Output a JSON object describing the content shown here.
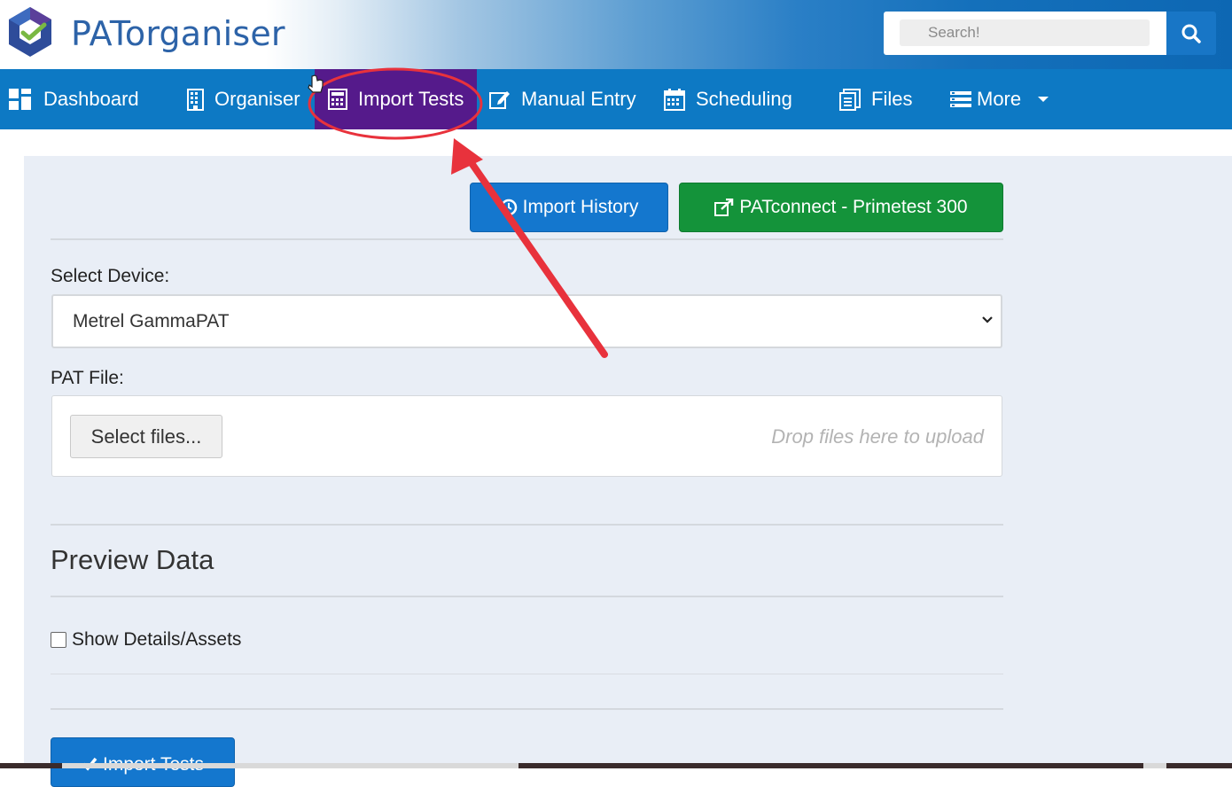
{
  "header": {
    "brand": "PATorganiser",
    "search_placeholder": "Search!",
    "accent": "#0d79c4"
  },
  "nav": {
    "items": [
      {
        "label": "Dashboard",
        "icon": "dashboard-icon"
      },
      {
        "label": "Organiser",
        "icon": "building-icon"
      },
      {
        "label": "Import Tests",
        "icon": "calculator-icon",
        "active": true
      },
      {
        "label": "Manual Entry",
        "icon": "edit-icon"
      },
      {
        "label": "Scheduling",
        "icon": "calendar-icon"
      },
      {
        "label": "Files",
        "icon": "files-icon"
      },
      {
        "label": "More",
        "icon": "menu-icon"
      }
    ],
    "active_color": "#551a8b"
  },
  "main": {
    "import_history_label": "Import History",
    "patconnect_label": "PATconnect - Primetest 300",
    "select_device_label": "Select Device:",
    "device_value": "Metrel GammaPAT",
    "pat_file_label": "PAT File:",
    "select_files_label": "Select files...",
    "drop_hint": "Drop files here to upload",
    "preview_title": "Preview Data",
    "show_details_label": "Show Details/Assets",
    "show_details_checked": false,
    "import_tests_button": "Import Tests"
  },
  "annotation": {
    "color": "#e8323c"
  }
}
